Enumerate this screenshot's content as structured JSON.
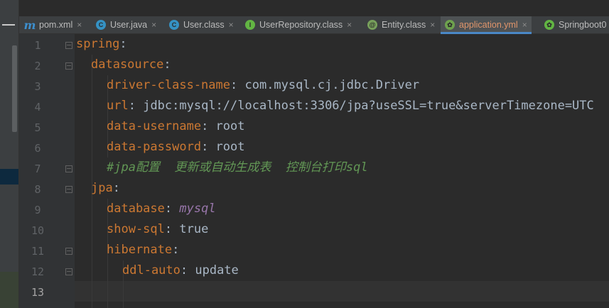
{
  "tabs": [
    {
      "label": "pom.xml",
      "icon": "maven-icon",
      "glyph": "m"
    },
    {
      "label": "User.java",
      "icon": "class-icon",
      "glyph": "C"
    },
    {
      "label": "User.class",
      "icon": "class-icon",
      "glyph": "C"
    },
    {
      "label": "UserRepository.class",
      "icon": "interface-icon",
      "glyph": "I"
    },
    {
      "label": "Entity.class",
      "icon": "annotation-icon",
      "glyph": "@"
    },
    {
      "label": "application.yml",
      "icon": "spring-config-icon",
      "glyph": "✿",
      "active": true
    },
    {
      "label": "Springboot0",
      "icon": "spring-boot-icon",
      "glyph": "✿"
    }
  ],
  "close_glyph": "×",
  "line_numbers": [
    "1",
    "2",
    "3",
    "4",
    "5",
    "6",
    "7",
    "8",
    "9",
    "10",
    "11",
    "12",
    "13"
  ],
  "code": {
    "l1": {
      "key": "spring",
      "colon": ":"
    },
    "l2": {
      "key": "datasource",
      "colon": ":"
    },
    "l3": {
      "key": "driver-class-name",
      "colon": ": ",
      "value": "com.mysql.cj.jdbc.Driver"
    },
    "l4": {
      "key": "url",
      "colon": ": ",
      "value": "jdbc:mysql://localhost:3306/jpa?useSSL=true&serverTimezone=UTC"
    },
    "l5": {
      "key": "data-username",
      "colon": ": ",
      "value": "root"
    },
    "l6": {
      "key": "data-password",
      "colon": ": ",
      "value": "root"
    },
    "l7": {
      "comment": "#jpa配置  更新或自动生成表  控制台打印sql"
    },
    "l8": {
      "key": "jpa",
      "colon": ":"
    },
    "l9": {
      "key": "database",
      "colon": ": ",
      "value": "mysql"
    },
    "l10": {
      "key": "show-sql",
      "colon": ": ",
      "value": "true"
    },
    "l11": {
      "key": "hibernate",
      "colon": ":"
    },
    "l12": {
      "key": "ddl-auto",
      "colon": ": ",
      "value": "update"
    }
  },
  "colors": {
    "key": "#cc7832",
    "value": "#a9b7c6",
    "comment": "#629755",
    "enum": "#9876aa",
    "background": "#2b2b2b"
  }
}
